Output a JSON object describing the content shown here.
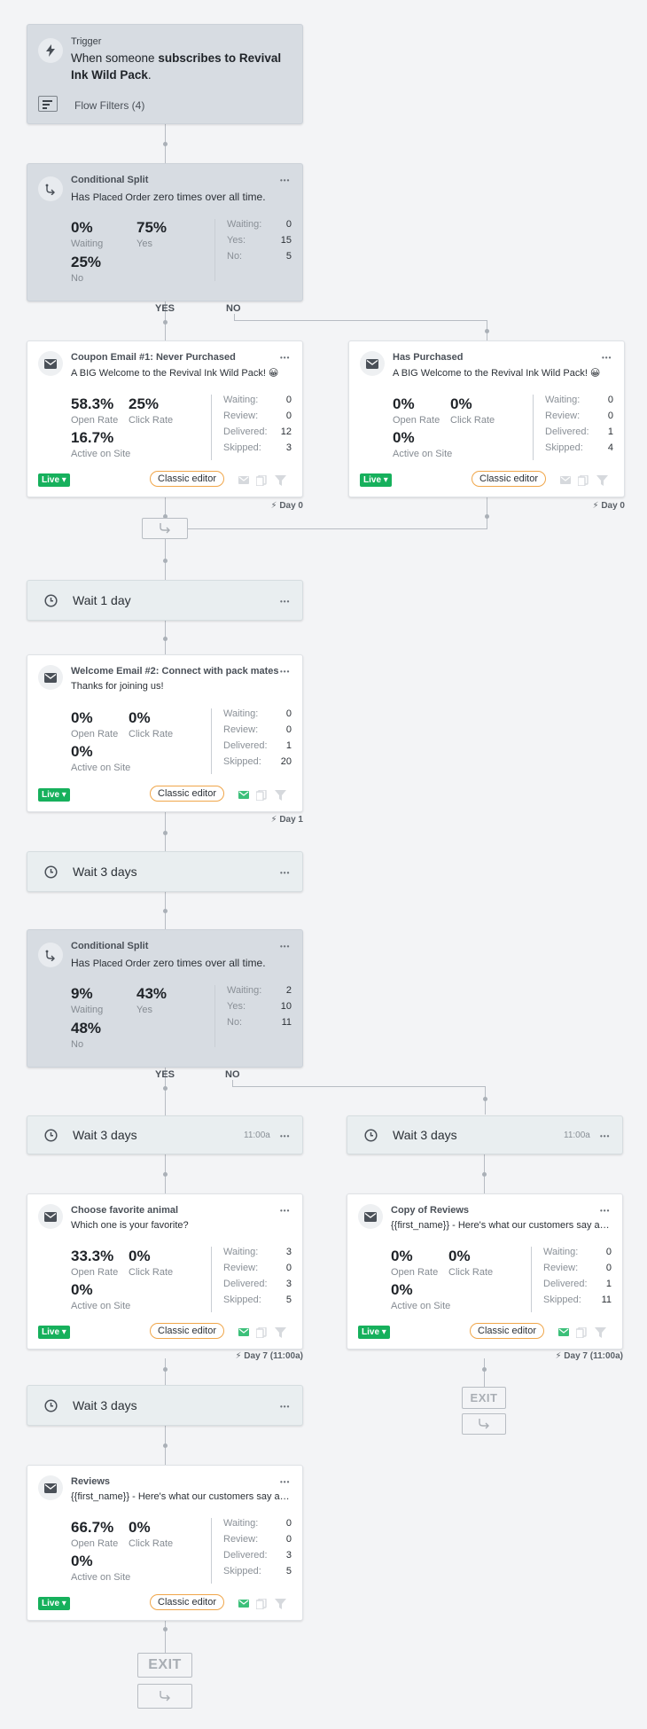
{
  "trigger": {
    "title": "Trigger",
    "line1_pre": "When someone ",
    "line1_bold": "subscribes to Revival",
    "line2_bold": "Ink Wild Pack",
    "line2_end": ".",
    "filters": "Flow Filters (4)"
  },
  "split1": {
    "title": "Conditional Split",
    "text_pre": "Has ",
    "text_em": "Placed Order",
    "text_post": " zero times over all time.",
    "waiting_pct": "0%",
    "waiting_lbl": "Waiting",
    "yes_pct": "75%",
    "yes_lbl": "Yes",
    "no_pct": "25%",
    "no_lbl": "No",
    "stats": [
      [
        "Waiting:",
        "0"
      ],
      [
        "Yes:",
        "15"
      ],
      [
        "No:",
        "5"
      ]
    ]
  },
  "branch_labels": {
    "yes": "YES",
    "no": "NO"
  },
  "coupon": {
    "title": "Coupon Email #1: Never Purchased",
    "subtitle": "A BIG Welcome to the Revival Ink Wild Pack! 😀",
    "open": "58.3%",
    "click": "25%",
    "active": "16.7%",
    "open_lbl": "Open Rate",
    "click_lbl": "Click Rate",
    "active_lbl": "Active on Site",
    "stats": [
      [
        "Waiting:",
        "0"
      ],
      [
        "Review:",
        "0"
      ],
      [
        "Delivered:",
        "12"
      ],
      [
        "Skipped:",
        "3"
      ]
    ],
    "live": "Live ▾",
    "classic": "Classic editor",
    "day": "Day 0"
  },
  "purchased": {
    "title": "Has Purchased",
    "subtitle": "A BIG Welcome to the Revival Ink Wild Pack! 😀",
    "open": "0%",
    "click": "0%",
    "active": "0%",
    "open_lbl": "Open Rate",
    "click_lbl": "Click Rate",
    "active_lbl": "Active on Site",
    "stats": [
      [
        "Waiting:",
        "0"
      ],
      [
        "Review:",
        "0"
      ],
      [
        "Delivered:",
        "1"
      ],
      [
        "Skipped:",
        "4"
      ]
    ],
    "live": "Live ▾",
    "classic": "Classic editor",
    "day": "Day 0"
  },
  "wait1": {
    "label": "Wait 1 day"
  },
  "welcome2": {
    "title": "Welcome Email #2: Connect with pack mates",
    "subtitle": "Thanks for joining us!",
    "open": "0%",
    "click": "0%",
    "active": "0%",
    "open_lbl": "Open Rate",
    "click_lbl": "Click Rate",
    "active_lbl": "Active on Site",
    "stats": [
      [
        "Waiting:",
        "0"
      ],
      [
        "Review:",
        "0"
      ],
      [
        "Delivered:",
        "1"
      ],
      [
        "Skipped:",
        "20"
      ]
    ],
    "live": "Live ▾",
    "classic": "Classic editor",
    "day": "Day 1"
  },
  "wait3a": {
    "label": "Wait 3 days"
  },
  "split2": {
    "title": "Conditional Split",
    "text_pre": "Has ",
    "text_em": "Placed Order",
    "text_post": " zero times over all time.",
    "waiting_pct": "9%",
    "waiting_lbl": "Waiting",
    "yes_pct": "43%",
    "yes_lbl": "Yes",
    "no_pct": "48%",
    "no_lbl": "No",
    "stats": [
      [
        "Waiting:",
        "2"
      ],
      [
        "Yes:",
        "10"
      ],
      [
        "No:",
        "11"
      ]
    ]
  },
  "wait3b": {
    "label": "Wait 3 days",
    "time": "11:00a"
  },
  "wait3c": {
    "label": "Wait 3 days",
    "time": "11:00a"
  },
  "animal": {
    "title": "Choose favorite animal",
    "subtitle": "Which one is your favorite?",
    "open": "33.3%",
    "click": "0%",
    "active": "0%",
    "open_lbl": "Open Rate",
    "click_lbl": "Click Rate",
    "active_lbl": "Active on Site",
    "stats": [
      [
        "Waiting:",
        "3"
      ],
      [
        "Review:",
        "0"
      ],
      [
        "Delivered:",
        "3"
      ],
      [
        "Skipped:",
        "5"
      ]
    ],
    "live": "Live ▾",
    "classic": "Classic editor",
    "day": "Day 7 (11:00a)"
  },
  "copyreviews": {
    "title": "Copy of Reviews",
    "subtitle": "{{first_name}} - Here's what our customers say ab...",
    "open": "0%",
    "click": "0%",
    "active": "0%",
    "open_lbl": "Open Rate",
    "click_lbl": "Click Rate",
    "active_lbl": "Active on Site",
    "stats": [
      [
        "Waiting:",
        "0"
      ],
      [
        "Review:",
        "0"
      ],
      [
        "Delivered:",
        "1"
      ],
      [
        "Skipped:",
        "11"
      ]
    ],
    "live": "Live ▾",
    "classic": "Classic editor",
    "day": "Day 7 (11:00a)"
  },
  "wait3d": {
    "label": "Wait 3 days"
  },
  "reviews": {
    "title": "Reviews",
    "subtitle": "{{first_name}} - Here's what our customers say ab...",
    "open": "66.7%",
    "click": "0%",
    "active": "0%",
    "open_lbl": "Open Rate",
    "click_lbl": "Click Rate",
    "active_lbl": "Active on Site",
    "stats": [
      [
        "Waiting:",
        "0"
      ],
      [
        "Review:",
        "0"
      ],
      [
        "Delivered:",
        "3"
      ],
      [
        "Skipped:",
        "5"
      ]
    ],
    "live": "Live ▾",
    "classic": "Classic editor"
  },
  "exit": "EXIT",
  "menu_dots": "•••"
}
